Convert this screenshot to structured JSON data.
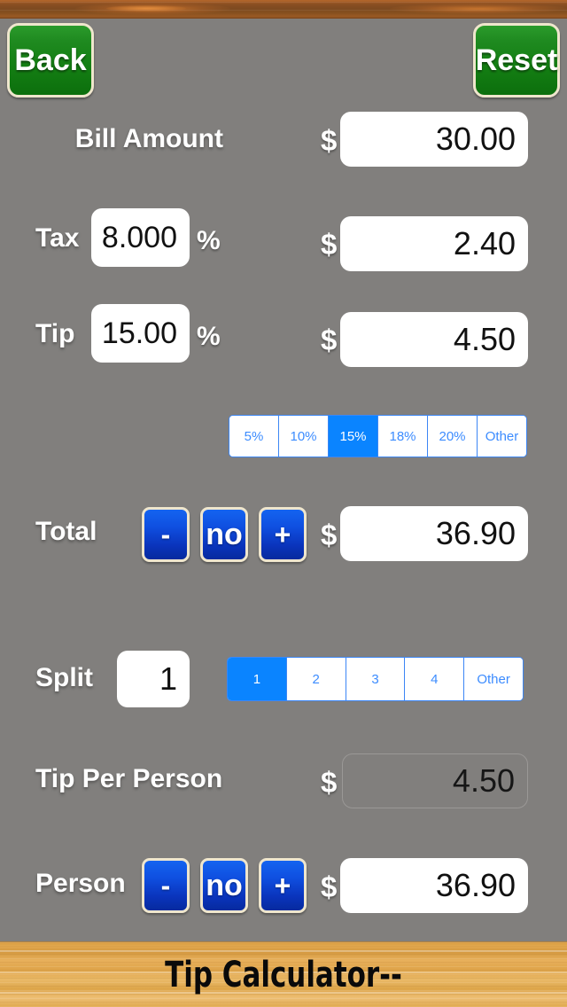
{
  "app": {
    "title": "Tip Calculator--"
  },
  "header": {
    "back_label": "Back",
    "reset_label": "Reset"
  },
  "rows": {
    "bill": {
      "label": "Bill Amount",
      "currency": "$",
      "amount": "30.00"
    },
    "tax": {
      "label": "Tax",
      "percent": "8.000",
      "percent_symbol": "%",
      "currency": "$",
      "amount": "2.40"
    },
    "tip": {
      "label": "Tip",
      "percent": "15.00",
      "percent_symbol": "%",
      "currency": "$",
      "amount": "4.50"
    },
    "total": {
      "label": "Total",
      "minus_label": "-",
      "no_label": "no",
      "plus_label": "+",
      "currency": "$",
      "amount": "36.90"
    },
    "split": {
      "label": "Split",
      "count": "1"
    },
    "tip_per_person": {
      "label": "Tip Per Person",
      "currency": "$",
      "amount": "4.50"
    },
    "person": {
      "label": "Person",
      "minus_label": "-",
      "no_label": "no",
      "plus_label": "+",
      "currency": "$",
      "amount": "36.90"
    }
  },
  "tip_segments": {
    "options": [
      "5%",
      "10%",
      "15%",
      "18%",
      "20%",
      "Other"
    ],
    "selected_index": 2
  },
  "split_segments": {
    "options": [
      "1",
      "2",
      "3",
      "4",
      "Other"
    ],
    "selected_index": 0
  },
  "colors": {
    "background": "#817f7d",
    "green_button": "#168014",
    "blue_button": "#0a34bc",
    "segment_selected": "#0a84ff",
    "segment_text": "#3c8cff",
    "wood_top": "#7d4a20",
    "wood_bottom": "#e0a94f"
  }
}
